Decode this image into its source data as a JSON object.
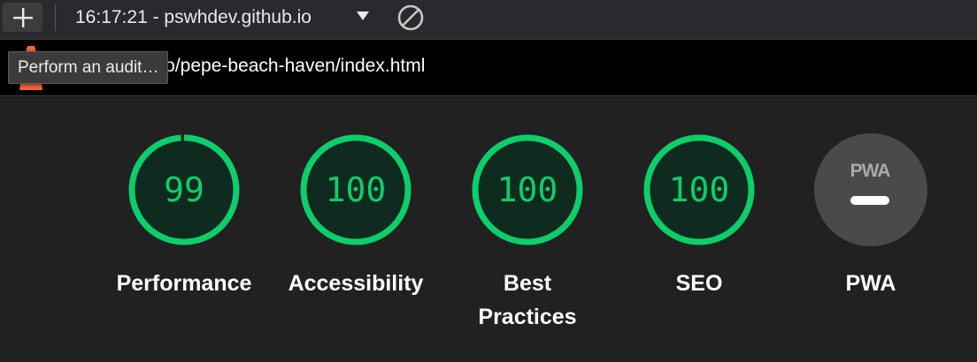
{
  "toolbar": {
    "add_button_tooltip": "Perform an audit…",
    "report_selector": "16:17:21 - pswhdev.github.io",
    "caret_icon": "caret-down-icon",
    "clear_icon": "block-icon"
  },
  "urlbar": {
    "url": "https://pswhdev.github.io/pepe-beach-haven/index.html",
    "visible_url": "ev.github.io/pepe-beach-haven/index.html",
    "logo_icon": "lighthouse-icon"
  },
  "colors": {
    "pass": "#0cce6b",
    "pass_fill": "#0f2a1e",
    "pwa_fill": "#4a4a4a",
    "background": "#212121"
  },
  "gauges": [
    {
      "category": "Performance",
      "score": "99",
      "fraction": 0.99
    },
    {
      "category": "Accessibility",
      "score": "100",
      "fraction": 1.0
    },
    {
      "category": "Best Practices",
      "score": "100",
      "fraction": 1.0
    },
    {
      "category": "SEO",
      "score": "100",
      "fraction": 1.0
    },
    {
      "category": "PWA",
      "score": "",
      "badge": "PWA",
      "state": "not-applicable"
    }
  ]
}
